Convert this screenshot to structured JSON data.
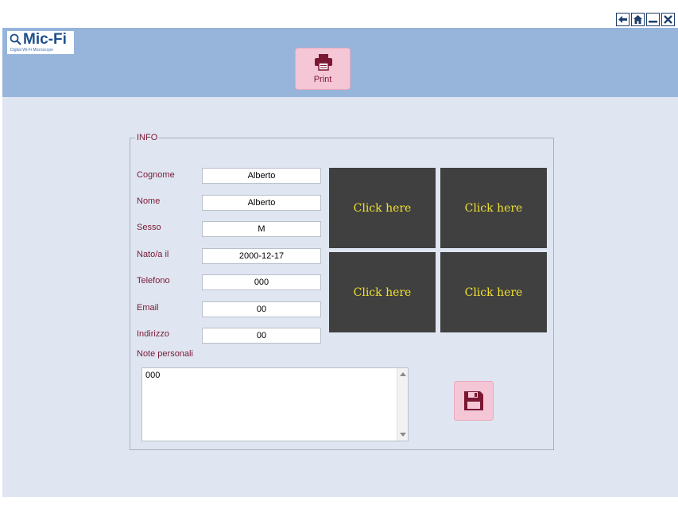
{
  "window": {
    "controls": [
      {
        "icon": "arrow-left-icon"
      },
      {
        "icon": "home-icon"
      },
      {
        "icon": "minimize-icon"
      },
      {
        "icon": "close-icon"
      }
    ]
  },
  "header": {
    "logo": {
      "text": "Mic-Fi",
      "subtitle": "Digital Wi-Fi Microscope"
    },
    "print_label": "Print"
  },
  "info": {
    "legend": "INFO",
    "fields": [
      {
        "label": "Cognome",
        "value": "Alberto"
      },
      {
        "label": "Nome",
        "value": "Alberto"
      },
      {
        "label": "Sesso",
        "value": "M"
      },
      {
        "label": "Nato/a il",
        "value": "2000-12-17"
      },
      {
        "label": "Telefono",
        "value": "000"
      },
      {
        "label": "Email",
        "value": "00"
      },
      {
        "label": "Indirizzo",
        "value": "00"
      }
    ],
    "notes_label": "Note personali",
    "notes_value": "000",
    "tiles": [
      "Click here",
      "Click here",
      "Click here",
      "Click here"
    ]
  },
  "colors": {
    "header_bg": "#97b4da",
    "main_bg": "#dfe6f1",
    "label_color": "#7a1834",
    "tile_bg": "#404040",
    "tile_text": "#f0e030",
    "button_bg": "#f4c6d6"
  }
}
